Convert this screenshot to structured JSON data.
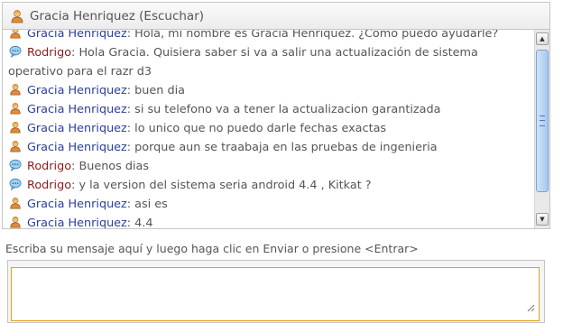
{
  "header": {
    "title": "Gracia Henriquez (Escuchar)"
  },
  "messages": [
    {
      "role": "agent",
      "sender": "Gracia Henriquez",
      "text": "Hola, mi nombre es Gracia Henriquez. ¿Cómo puedo ayudarle?"
    },
    {
      "role": "user",
      "sender": "Rodrigo",
      "text": "Hola Gracia. Quisiera saber si va a salir una actualización de sistema operativo para el razr d3"
    },
    {
      "role": "agent",
      "sender": "Gracia Henriquez",
      "text": "buen dia"
    },
    {
      "role": "agent",
      "sender": "Gracia Henriquez",
      "text": "si su telefono va a tener la actualizacion garantizada"
    },
    {
      "role": "agent",
      "sender": "Gracia Henriquez",
      "text": "lo unico que no puedo darle fechas exactas"
    },
    {
      "role": "agent",
      "sender": "Gracia Henriquez",
      "text": "porque aun se traabaja en las pruebas de ingenieria"
    },
    {
      "role": "user",
      "sender": "Rodrigo",
      "text": "Buenos dias"
    },
    {
      "role": "user",
      "sender": "Rodrigo",
      "text": "y la version del sistema seria android 4.4 , Kitkat ?"
    },
    {
      "role": "agent",
      "sender": "Gracia Henriquez",
      "text": "asi es"
    },
    {
      "role": "agent",
      "sender": "Gracia Henriquez",
      "text": "4.4"
    }
  ],
  "scrollbar": {
    "up_arrow": "▲",
    "down_arrow": "▼"
  },
  "input": {
    "instructions": "Escriba su mensaje aquí y luego haga clic en Enviar o presione <Entrar>",
    "value": "",
    "placeholder": ""
  },
  "icons": {
    "agent": "agent-person-icon",
    "user": "speech-bubble-icon"
  },
  "colors": {
    "agent_name": "#2a3f9a",
    "user_name": "#8b1c1c",
    "input_focus_border": "#e4a11b",
    "scrollbar_thumb": "#a9c9ee"
  }
}
